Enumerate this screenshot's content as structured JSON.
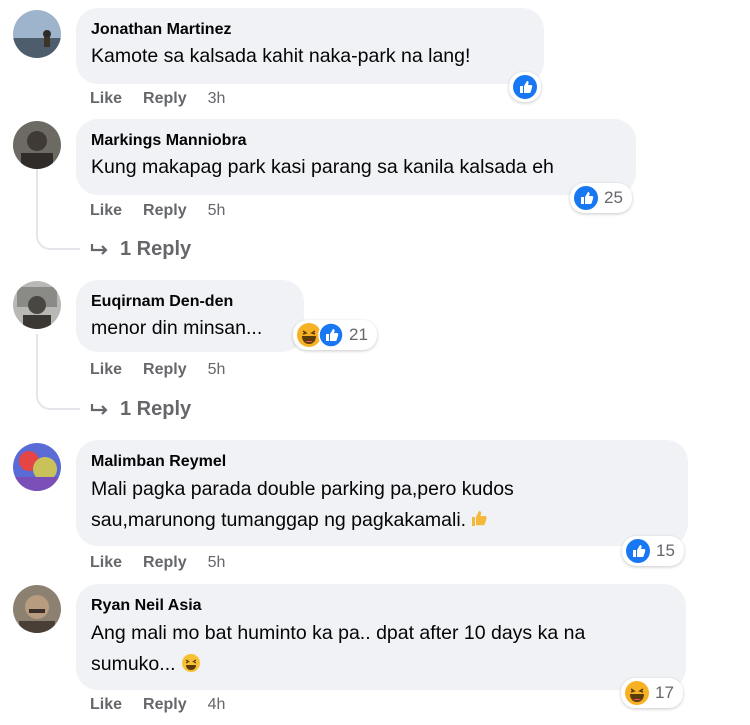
{
  "actions": {
    "like": "Like",
    "reply": "Reply"
  },
  "colors": {
    "bubble": "#f0f2f5",
    "secondary_text": "#65676b",
    "like_blue": "#1877f2",
    "haha_yellow": "#f7b125"
  },
  "comments": [
    {
      "author": "Jonathan Martinez",
      "text": "Kamote sa kalsada kahit naka-park na lang!",
      "time": "3h",
      "reactions": [
        "like"
      ],
      "reaction_count": ""
    },
    {
      "author": "Markings Manniobra",
      "text": "Kung makapag park kasi parang sa kanila kalsada eh",
      "time": "5h",
      "reactions": [
        "like"
      ],
      "reaction_count": "25",
      "replies_label": "1 Reply"
    },
    {
      "author": "Euqirnam Den-den",
      "text": "menor din minsan...",
      "time": "5h",
      "reactions": [
        "haha",
        "like"
      ],
      "reaction_count": "21",
      "replies_label": "1 Reply"
    },
    {
      "author": "Malimban Reymel",
      "text_line1": "Mali pagka parada double parking pa,pero kudos",
      "text_line2": "sau,marunong tumanggap ng pagkakamali.",
      "time": "5h",
      "reactions": [
        "like"
      ],
      "reaction_count": "15"
    },
    {
      "author": "Ryan Neil Asia",
      "text_line1": "Ang mali mo bat huminto ka pa.. dpat after 10 days ka na",
      "text_line2": "sumuko...",
      "time": "4h",
      "reactions": [
        "haha"
      ],
      "reaction_count": "17"
    }
  ]
}
